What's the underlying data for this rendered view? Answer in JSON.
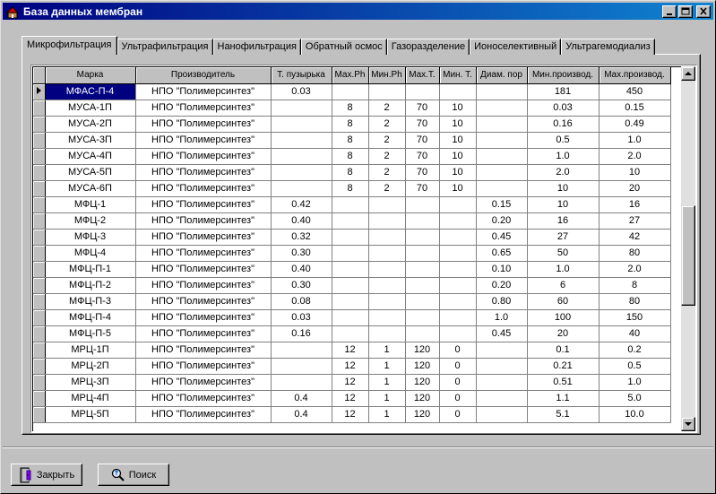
{
  "window": {
    "title": "База данных мембран"
  },
  "tabs": [
    {
      "label": "Микрофильтрация",
      "active": true
    },
    {
      "label": "Ультрафильтрация",
      "active": false
    },
    {
      "label": "Нанофильтрация",
      "active": false
    },
    {
      "label": "Обратный осмос",
      "active": false
    },
    {
      "label": "Газоразделение",
      "active": false
    },
    {
      "label": "Ионоселективный",
      "active": false
    },
    {
      "label": "Ультрагемодиализ",
      "active": false
    }
  ],
  "table": {
    "columns": [
      "Марка",
      "Производитель",
      "Т. пузырька",
      "Max.Ph",
      "Мин.Ph",
      "Max.T.",
      "Мин. Т.",
      "Диам. пор",
      "Мин.производ.",
      "Max.производ."
    ],
    "selected_row": 0,
    "rows": [
      [
        "МФАС-П-4",
        "НПО \"Полимерсинтез\"",
        "0.03",
        "",
        "",
        "",
        "",
        "",
        "181",
        "450"
      ],
      [
        "МУСА-1П",
        "НПО \"Полимерсинтез\"",
        "",
        "8",
        "2",
        "70",
        "10",
        "",
        "0.03",
        "0.15"
      ],
      [
        "МУСА-2П",
        "НПО \"Полимерсинтез\"",
        "",
        "8",
        "2",
        "70",
        "10",
        "",
        "0.16",
        "0.49"
      ],
      [
        "МУСА-3П",
        "НПО \"Полимерсинтез\"",
        "",
        "8",
        "2",
        "70",
        "10",
        "",
        "0.5",
        "1.0"
      ],
      [
        "МУСА-4П",
        "НПО \"Полимерсинтез\"",
        "",
        "8",
        "2",
        "70",
        "10",
        "",
        "1.0",
        "2.0"
      ],
      [
        "МУСА-5П",
        "НПО \"Полимерсинтез\"",
        "",
        "8",
        "2",
        "70",
        "10",
        "",
        "2.0",
        "10"
      ],
      [
        "МУСА-6П",
        "НПО \"Полимерсинтез\"",
        "",
        "8",
        "2",
        "70",
        "10",
        "",
        "10",
        "20"
      ],
      [
        "МФЦ-1",
        "НПО \"Полимерсинтез\"",
        "0.42",
        "",
        "",
        "",
        "",
        "0.15",
        "10",
        "16"
      ],
      [
        "МФЦ-2",
        "НПО \"Полимерсинтез\"",
        "0.40",
        "",
        "",
        "",
        "",
        "0.20",
        "16",
        "27"
      ],
      [
        "МФЦ-3",
        "НПО \"Полимерсинтез\"",
        "0.32",
        "",
        "",
        "",
        "",
        "0.45",
        "27",
        "42"
      ],
      [
        "МФЦ-4",
        "НПО \"Полимерсинтез\"",
        "0.30",
        "",
        "",
        "",
        "",
        "0.65",
        "50",
        "80"
      ],
      [
        "МФЦ-П-1",
        "НПО \"Полимерсинтез\"",
        "0.40",
        "",
        "",
        "",
        "",
        "0.10",
        "1.0",
        "2.0"
      ],
      [
        "МФЦ-П-2",
        "НПО \"Полимерсинтез\"",
        "0.30",
        "",
        "",
        "",
        "",
        "0.20",
        "6",
        "8"
      ],
      [
        "МФЦ-П-3",
        "НПО \"Полимерсинтез\"",
        "0.08",
        "",
        "",
        "",
        "",
        "0.80",
        "60",
        "80"
      ],
      [
        "МФЦ-П-4",
        "НПО \"Полимерсинтез\"",
        "0.03",
        "",
        "",
        "",
        "",
        "1.0",
        "100",
        "150"
      ],
      [
        "МФЦ-П-5",
        "НПО \"Полимерсинтез\"",
        "0.16",
        "",
        "",
        "",
        "",
        "0.45",
        "20",
        "40"
      ],
      [
        "МРЦ-1П",
        "НПО \"Полимерсинтез\"",
        "",
        "12",
        "1",
        "120",
        "0",
        "",
        "0.1",
        "0.2"
      ],
      [
        "МРЦ-2П",
        "НПО \"Полимерсинтез\"",
        "",
        "12",
        "1",
        "120",
        "0",
        "",
        "0.21",
        "0.5"
      ],
      [
        "МРЦ-3П",
        "НПО \"Полимерсинтез\"",
        "",
        "12",
        "1",
        "120",
        "0",
        "",
        "0.51",
        "1.0"
      ],
      [
        "МРЦ-4П",
        "НПО \"Полимерсинтез\"",
        "0.4",
        "12",
        "1",
        "120",
        "0",
        "",
        "1.1",
        "5.0"
      ],
      [
        "МРЦ-5П",
        "НПО \"Полимерсинтез\"",
        "0.4",
        "12",
        "1",
        "120",
        "0",
        "",
        "5.1",
        "10.0"
      ]
    ]
  },
  "buttons": {
    "close_label": "Закрыть",
    "search_label": "Поиск"
  },
  "colors": {
    "title_start": "#000080",
    "title_end": "#1084d0",
    "selection": "#000080"
  }
}
